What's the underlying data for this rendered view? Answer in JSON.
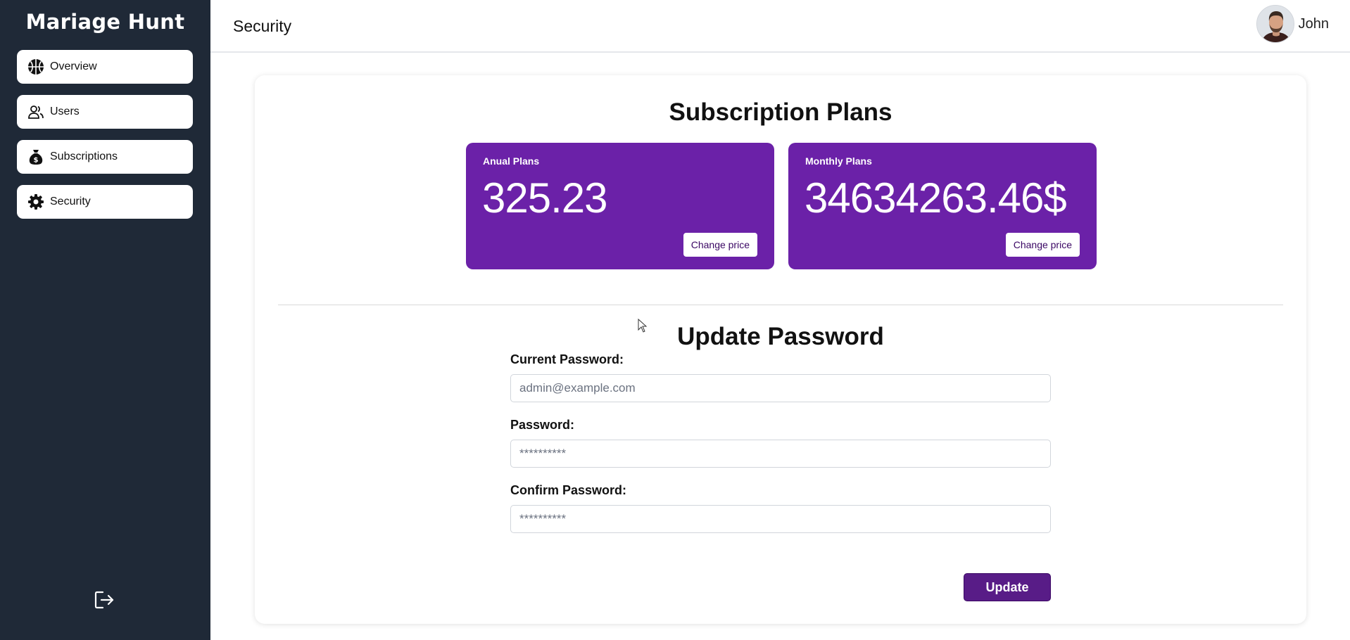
{
  "app": {
    "brand": "Mariage Hunt"
  },
  "sidebar": {
    "items": [
      {
        "label": "Overview",
        "icon": "basketball-icon"
      },
      {
        "label": "Users",
        "icon": "users-icon"
      },
      {
        "label": "Subscriptions",
        "icon": "money-bag-icon"
      },
      {
        "label": "Security",
        "icon": "gear-icon"
      }
    ],
    "active": "Security",
    "logout_icon": "logout-icon"
  },
  "header": {
    "title": "Security",
    "user_name": "John"
  },
  "subscription": {
    "title": "Subscription Plans",
    "plans": [
      {
        "label": "Anual Plans",
        "value": "325.23",
        "button": "Change price"
      },
      {
        "label": "Monthly Plans",
        "value": "34634263.46$",
        "button": "Change price"
      }
    ]
  },
  "password_form": {
    "title": "Update Password",
    "current_label": "Current Password:",
    "current_placeholder": "admin@example.com",
    "password_label": "Password:",
    "password_placeholder": "**********",
    "confirm_label": "Confirm Password:",
    "confirm_placeholder": "**********",
    "submit_label": "Update"
  },
  "colors": {
    "sidebar_bg": "#1f2937",
    "plan_card": "#6b21a8",
    "update_button": "#581c87"
  }
}
